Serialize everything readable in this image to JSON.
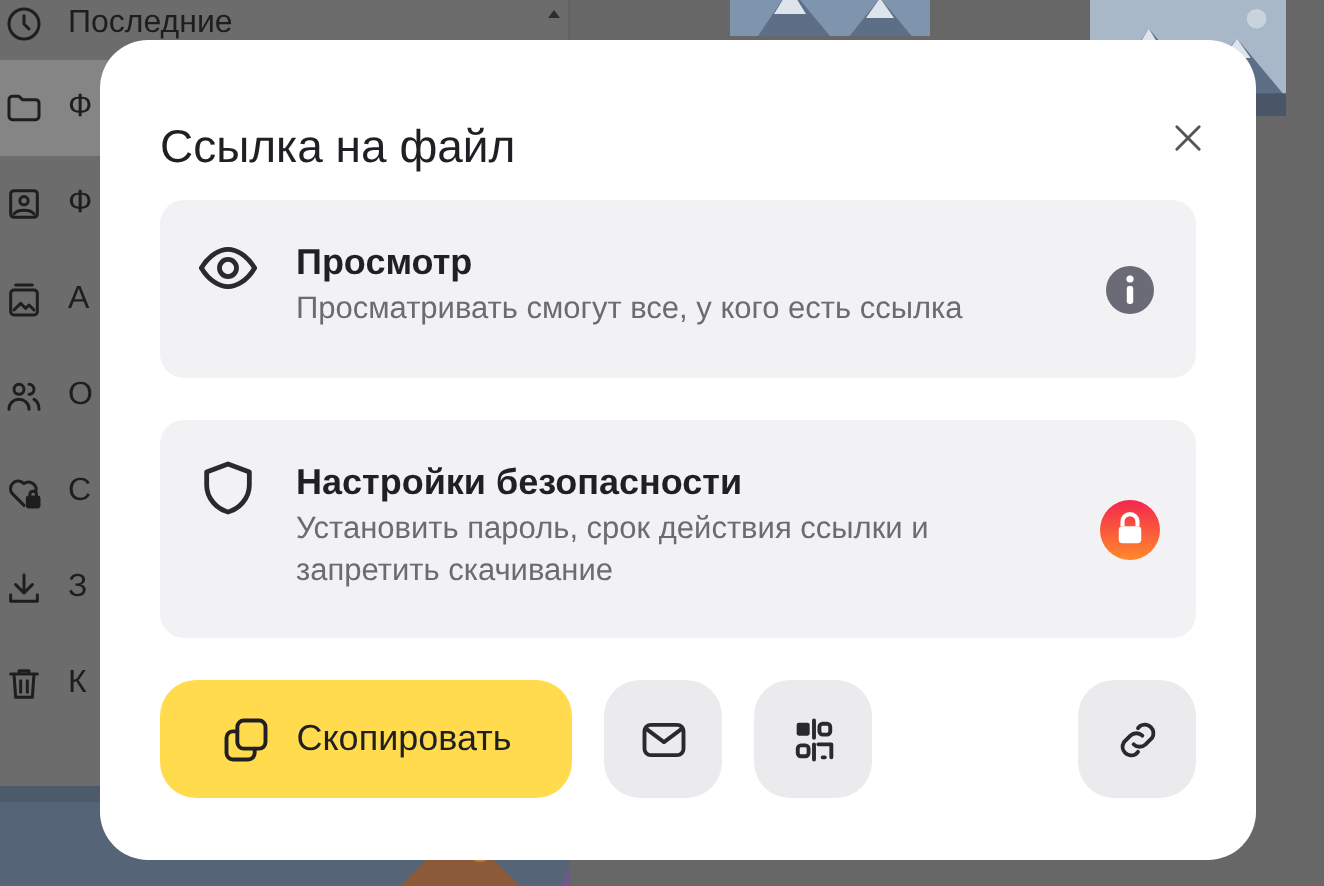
{
  "sidebar": {
    "items": [
      {
        "label": "Последние",
        "selected": false
      },
      {
        "label": "Ф",
        "selected": true
      },
      {
        "label": "Ф",
        "selected": false
      },
      {
        "label": "А",
        "selected": false
      },
      {
        "label": "О",
        "selected": false
      },
      {
        "label": "С",
        "selected": false
      },
      {
        "label": "З",
        "selected": false
      },
      {
        "label": "К",
        "selected": false
      }
    ]
  },
  "dialog": {
    "title": "Ссылка на файл",
    "options": [
      {
        "kind": "view",
        "title": "Просмотр",
        "description": "Просматривать смогут все, у кого есть ссылка"
      },
      {
        "kind": "security",
        "title": "Настройки безопасности",
        "description": "Установить пароль, срок действия ссылки и запретить скачивание"
      }
    ],
    "actions": [
      {
        "kind": "copy",
        "label": "Скопировать"
      },
      {
        "kind": "mail"
      },
      {
        "kind": "qr"
      },
      {
        "kind": "link"
      }
    ]
  }
}
